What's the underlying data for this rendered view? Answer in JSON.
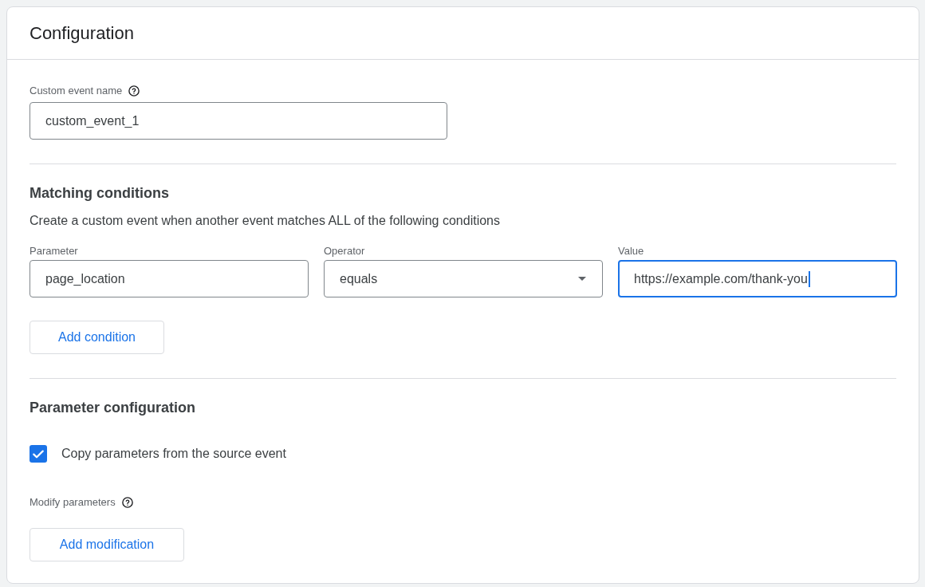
{
  "header": {
    "title": "Configuration"
  },
  "event_name": {
    "label": "Custom event name",
    "value": "custom_event_1",
    "focused": false
  },
  "matching_conditions": {
    "heading": "Matching conditions",
    "description": "Create a custom event when another event matches ALL of the following conditions",
    "fields": [
      {
        "kind": "text",
        "label": "Parameter",
        "value": "page_location",
        "focused": false
      },
      {
        "kind": "select",
        "label": "Operator",
        "value": "equals",
        "focused": false
      },
      {
        "kind": "text",
        "label": "Value",
        "value": "https://example.com/thank-you",
        "focused": true
      }
    ],
    "add_button": "Add condition"
  },
  "parameter_configuration": {
    "heading": "Parameter configuration",
    "copy_checkbox": {
      "label": "Copy parameters from the source event",
      "checked": true
    },
    "modify_label": "Modify parameters",
    "add_button": "Add modification"
  }
}
